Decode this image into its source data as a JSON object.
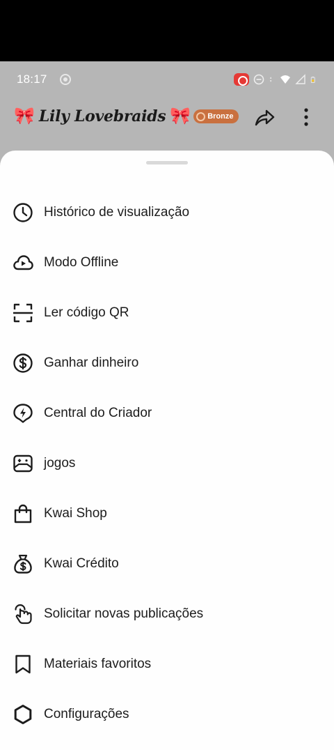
{
  "status_bar": {
    "time": "18:17"
  },
  "header": {
    "profile_name": "Lily Lovebraids",
    "decoration": "🎀",
    "badge_label": "Bronze",
    "accent_color": "#c9703f"
  },
  "menu": {
    "items": [
      {
        "label": "Histórico de visualização",
        "icon": "clock-icon"
      },
      {
        "label": "Modo Offline",
        "icon": "cloud-play-icon"
      },
      {
        "label": "Ler código QR",
        "icon": "qr-scan-icon"
      },
      {
        "label": "Ganhar dinheiro",
        "icon": "dollar-coin-icon"
      },
      {
        "label": "Central do Criador",
        "icon": "lightning-icon"
      },
      {
        "label": "jogos",
        "icon": "gamepad-icon"
      },
      {
        "label": "Kwai Shop",
        "icon": "shopping-bag-icon"
      },
      {
        "label": "Kwai Crédito",
        "icon": "money-bag-icon"
      },
      {
        "label": "Solicitar novas publicações",
        "icon": "tap-hand-icon"
      },
      {
        "label": "Materiais favoritos",
        "icon": "bookmark-icon"
      },
      {
        "label": "Configurações",
        "icon": "gear-icon"
      }
    ]
  }
}
